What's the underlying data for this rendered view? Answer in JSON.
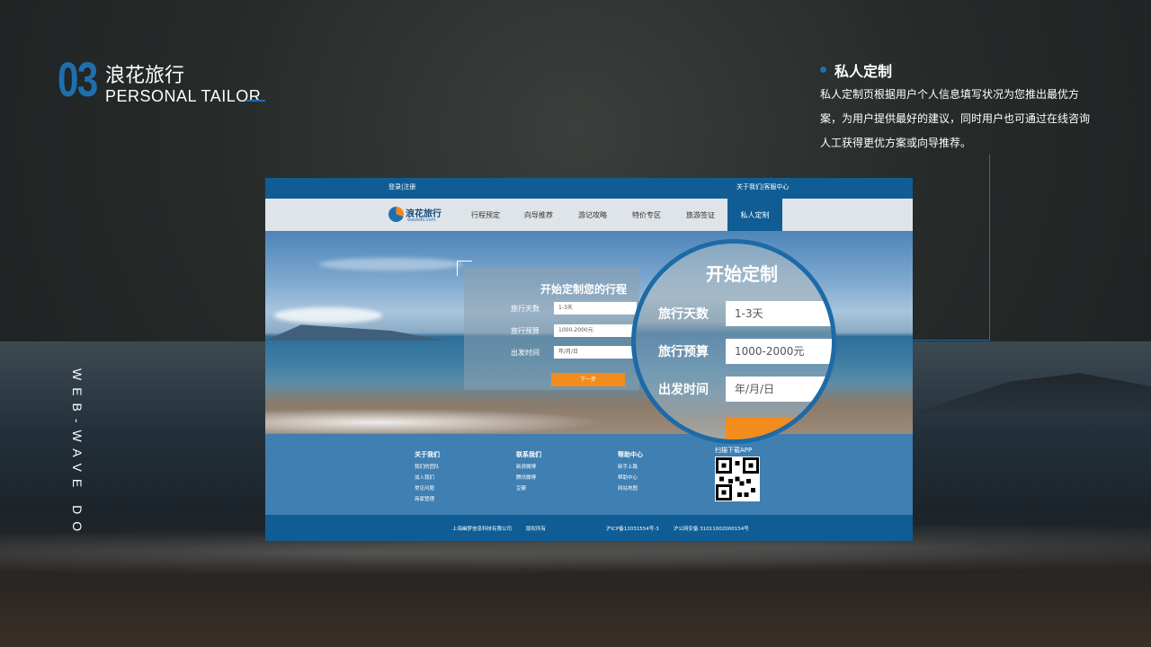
{
  "header": {
    "number": "03",
    "title_cn": "浪花旅行",
    "title_en": "PERSONAL TAILOR"
  },
  "side_vertical_text": "WEB-WAVE DO",
  "feature": {
    "title": "私人定制",
    "description": "私人定制页根据用户个人信息填写状况为您推出最优方案，为用户提供最好的建议，同时用户也可通过在线咨询人工获得更优方案或向导推荐。"
  },
  "mock": {
    "topbar": {
      "login": "登录|注册",
      "help": "关于我们|客服中心"
    },
    "logo": {
      "name": "浪花旅行",
      "domain": "wavedo.com"
    },
    "nav": [
      {
        "label": "行程预定"
      },
      {
        "label": "向导推荐"
      },
      {
        "label": "游记攻略"
      },
      {
        "label": "特价专区"
      },
      {
        "label": "旅游签证"
      },
      {
        "label": "私人定制"
      }
    ],
    "form": {
      "title": "开始定制您的行程",
      "fields": [
        {
          "label": "旅行天数",
          "value": "1-3天"
        },
        {
          "label": "旅行预算",
          "value": "1000-2000元"
        },
        {
          "label": "出发时间",
          "value": "年/月/日"
        }
      ],
      "button": "下一步"
    },
    "footer": {
      "columns": [
        {
          "title": "关于我们",
          "links": [
            "我们的团队",
            "加入我们",
            "常见问题",
            "商家管理"
          ]
        },
        {
          "title": "联系我们",
          "links": [
            "新浪微博",
            "腾讯微博",
            "豆瓣"
          ]
        },
        {
          "title": "帮助中心",
          "links": [
            "新手上路",
            "帮助中心",
            "网站地图"
          ]
        }
      ],
      "qr_title": "扫描下载APP",
      "company": "上海幽梦信息科技有限公司",
      "rights": "版权所有",
      "icp": "沪ICP备12031554号-3",
      "police": "沪公网安备 31011002000154号"
    }
  },
  "magnifier": {
    "title": "开始定制",
    "fields": [
      {
        "label": "旅行天数",
        "value": "1-3天"
      },
      {
        "label": "旅行预算",
        "value": "1000-2000元"
      },
      {
        "label": "出发时间",
        "value": "年/月/日"
      }
    ]
  },
  "colors": {
    "accent_blue": "#1e6fb0",
    "nav_blue": "#0f5d94",
    "button_orange": "#f28c1c"
  }
}
